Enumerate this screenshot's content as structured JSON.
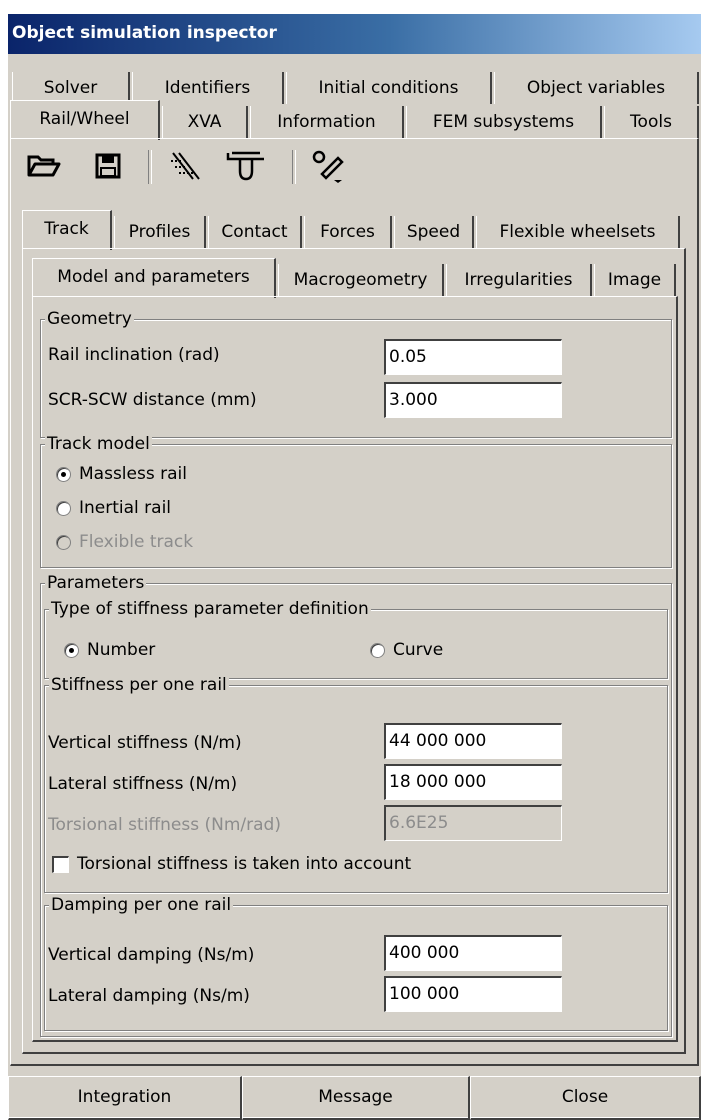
{
  "window": {
    "title": "Object simulation inspector"
  },
  "tabs_row1": [
    "Solver",
    "Identifiers",
    "Initial conditions",
    "Object variables"
  ],
  "tabs_row2": [
    "Rail/Wheel",
    "XVA",
    "Information",
    "FEM subsystems",
    "Tools"
  ],
  "toolbar_icons": [
    "open-folder-icon",
    "save-icon",
    "rail-icon",
    "wheel-profile-icon",
    "edit-settings-icon"
  ],
  "subtabs": [
    "Track",
    "Profiles",
    "Contact",
    "Forces",
    "Speed",
    "Flexible wheelsets"
  ],
  "subsubtabs": [
    "Model and parameters",
    "Macrogeometry",
    "Irregularities",
    "Image"
  ],
  "geometry": {
    "legend": "Geometry",
    "rail_inclination_label": "Rail inclination (rad)",
    "rail_inclination_value": "0.05",
    "scr_scw_label": "SCR-SCW distance (mm)",
    "scr_scw_value": "3.000"
  },
  "track_model": {
    "legend": "Track model",
    "options": [
      "Massless rail",
      "Inertial rail",
      "Flexible track"
    ],
    "selected": "Massless rail"
  },
  "parameters": {
    "legend": "Parameters",
    "type_legend": "Type of stiffness parameter definition",
    "type_options": [
      "Number",
      "Curve"
    ],
    "type_selected": "Number",
    "stiffness_legend": "Stiffness per one rail",
    "vertical_stiffness_label": "Vertical stiffness (N/m)",
    "vertical_stiffness_value": "44 000 000",
    "lateral_stiffness_label": "Lateral stiffness (N/m)",
    "lateral_stiffness_value": "18 000 000",
    "torsional_stiffness_label": "Torsional stiffness (Nm/rad)",
    "torsional_stiffness_value": "6.6E25",
    "torsional_checkbox_label": "Torsional stiffness is taken into account",
    "torsional_checkbox_checked": false,
    "damping_legend": "Damping per one rail",
    "vertical_damping_label": "Vertical damping (Ns/m)",
    "vertical_damping_value": "400 000",
    "lateral_damping_label": "Lateral damping (Ns/m)",
    "lateral_damping_value": "100 000"
  },
  "buttons": {
    "integration": "Integration",
    "message": "Message",
    "close": "Close"
  }
}
